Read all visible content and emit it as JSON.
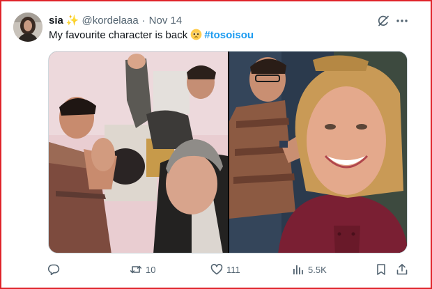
{
  "tweet": {
    "author_name": "sia",
    "author_emoji": "✨",
    "handle": "@kordelaaa",
    "separator": "·",
    "date": "Nov 14",
    "text": "My favourite character is back",
    "hashtag": "#tosoisou"
  },
  "media": {
    "photos": [
      {
        "label": "selfie of three men waving in a room"
      },
      {
        "label": "selfie of a smiling woman with a man waving behind her"
      }
    ]
  },
  "actions": {
    "reply_count": "",
    "repost_count": "10",
    "like_count": "111",
    "view_count": "5.5K"
  },
  "icons": {
    "reply": "reply-icon",
    "repost": "repost-icon",
    "like": "heart-icon",
    "views": "analytics-icon",
    "bookmark": "bookmark-icon",
    "share": "share-icon",
    "grok": "grok-icon",
    "more": "more-icon"
  },
  "colors": {
    "frame_border": "#e0242a",
    "accent": "#1d9bf0",
    "muted": "#536471",
    "text": "#0f1419"
  }
}
